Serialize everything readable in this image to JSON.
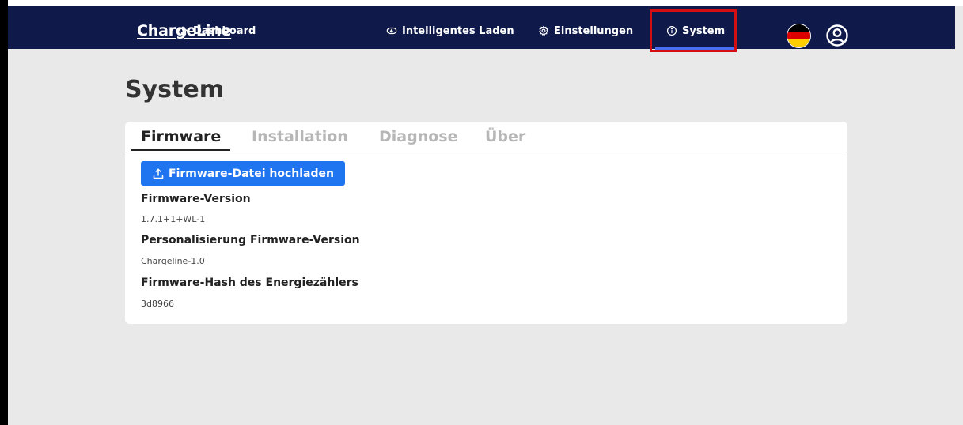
{
  "app": {
    "logo": "ChargeLine"
  },
  "nav": {
    "items": [
      {
        "label": "Dashboard",
        "icon": "home-icon"
      },
      {
        "label": "Intelligentes Laden",
        "icon": "smart-charging-icon"
      },
      {
        "label": "Einstellungen",
        "icon": "gear-icon"
      },
      {
        "label": "System",
        "icon": "info-icon",
        "active": true
      }
    ],
    "language_icon": "germany-flag-icon",
    "profile_icon": "user-profile-icon"
  },
  "page": {
    "title": "System"
  },
  "tabs": [
    {
      "label": "Firmware",
      "active": true
    },
    {
      "label": "Installation"
    },
    {
      "label": "Diagnose"
    },
    {
      "label": "Über"
    }
  ],
  "firmware": {
    "upload_label": "Firmware-Datei hochladen",
    "fields": [
      {
        "label": "Firmware-Version",
        "value": "1.7.1+1+WL-1"
      },
      {
        "label": "Personalisierung Firmware-Version",
        "value": "Chargeline-1.0"
      },
      {
        "label": "Firmware-Hash des Energiezählers",
        "value": "3d8966"
      }
    ]
  },
  "colors": {
    "navbar": "#0f1a4a",
    "accent": "#1f74f0",
    "highlight": "#d30f14",
    "active_underline": "#4a6ff2"
  }
}
